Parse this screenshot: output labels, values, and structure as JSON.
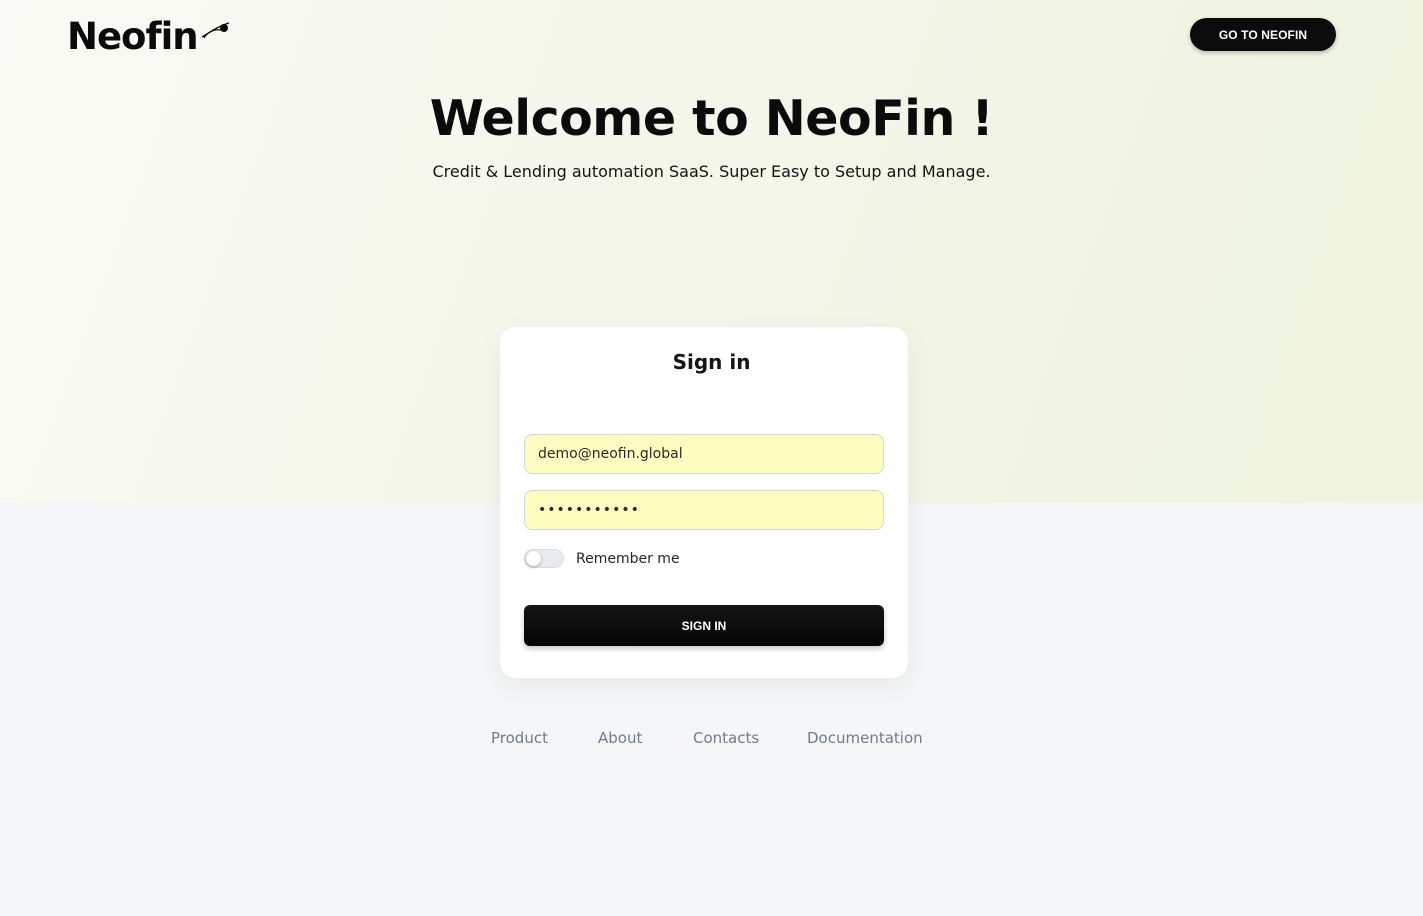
{
  "header": {
    "logo_text": "Neofin",
    "cta_label": "GO TO NEOFIN"
  },
  "hero": {
    "title": "Welcome to NeoFin !",
    "subtitle": "Credit & Lending automation SaaS. Super Easy to Setup and Manage."
  },
  "signin": {
    "title": "Sign in",
    "email_value": "demo@neofin.global",
    "password_value": "•••••••••••",
    "remember_label": "Remember me",
    "remember_checked": false,
    "submit_label": "SIGN IN"
  },
  "footer": {
    "links": [
      "Product",
      "About",
      "Contacts",
      "Documentation"
    ]
  },
  "colors": {
    "brand_dark": "#0b0b0b",
    "input_autofill": "#fdfdc0",
    "footer_link": "#6f7b8e"
  }
}
